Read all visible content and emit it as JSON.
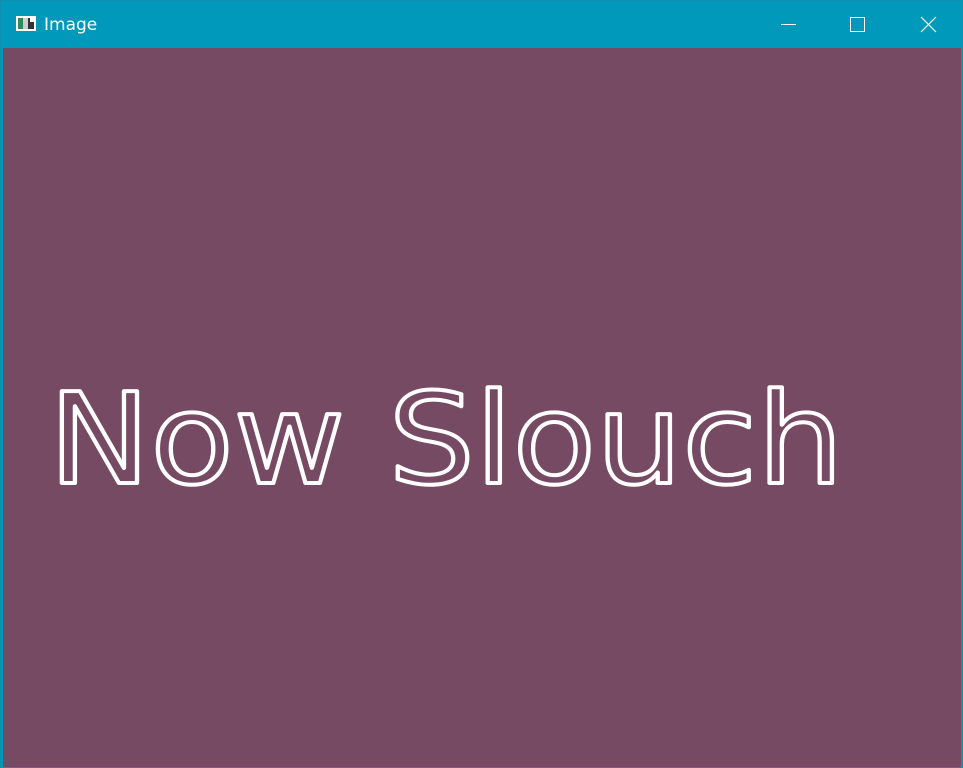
{
  "window": {
    "title": "Image",
    "controls": [
      "minimize-icon",
      "maximize-icon",
      "close-icon"
    ]
  },
  "canvas": {
    "text": "Now Slouch",
    "background": "#774a63",
    "text_color": "#ffffff"
  },
  "colors": {
    "titlebar": "#0099bc"
  }
}
